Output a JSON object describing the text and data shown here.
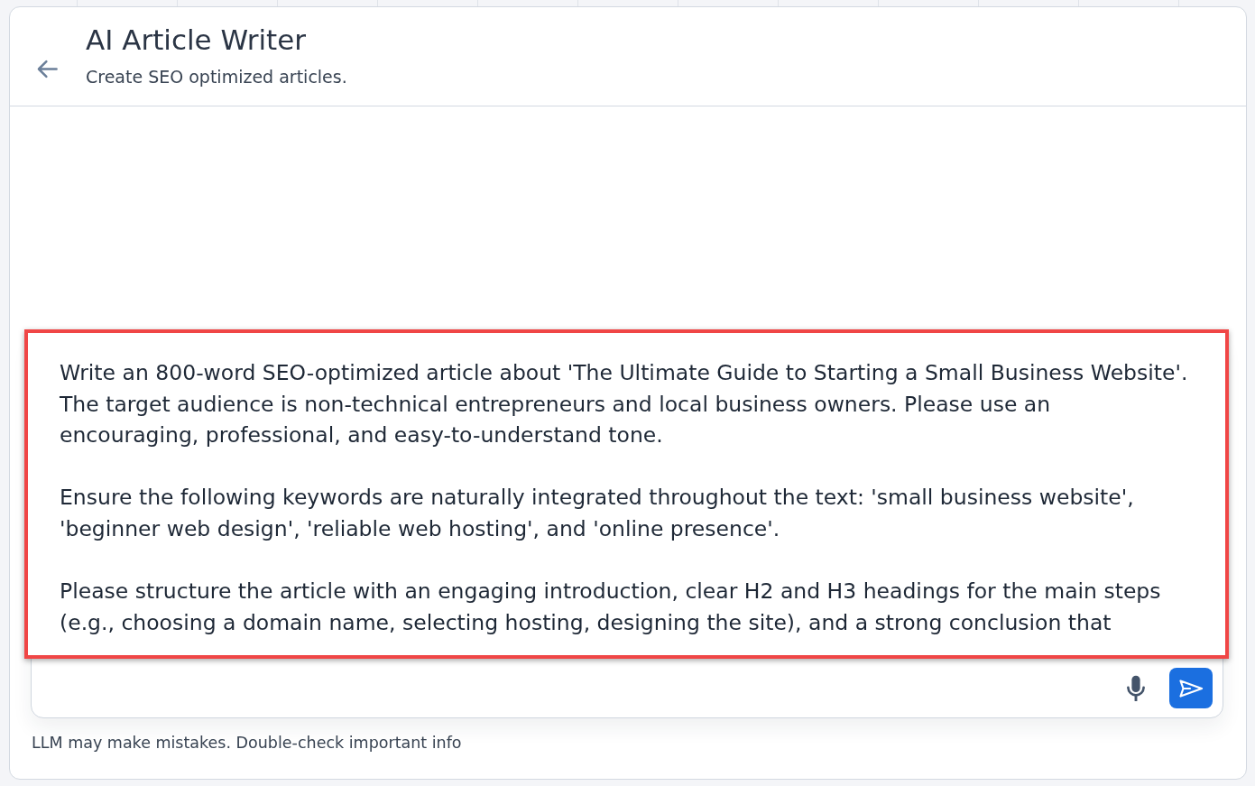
{
  "header": {
    "title": "AI Article Writer",
    "subtitle": "Create SEO optimized articles."
  },
  "composer": {
    "value": "Write an 800-word SEO-optimized article about 'The Ultimate Guide to Starting a Small Business Website'. The target audience is non-technical entrepreneurs and local business owners. Please use an encouraging, professional, and easy-to-understand tone.\n\nEnsure the following keywords are naturally integrated throughout the text: 'small business website', 'beginner web design', 'reliable web hosting', and 'online presence'.\n\nPlease structure the article with an engaging introduction, clear H2 and H3 headings for the main steps (e.g., choosing a domain name, selecting hosting, designing the site), and a strong conclusion that",
    "highlighted": true
  },
  "disclaimer": "LLM may make mistakes. Double-check important info"
}
